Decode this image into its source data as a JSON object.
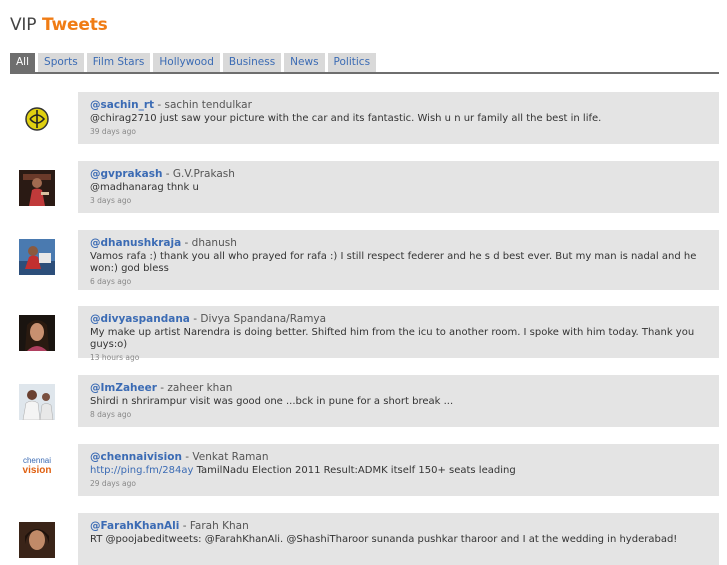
{
  "header": {
    "title_prefix": "VIP",
    "title_accent": "Tweets"
  },
  "tabs": [
    {
      "label": "All",
      "active": true
    },
    {
      "label": "Sports"
    },
    {
      "label": "Film Stars"
    },
    {
      "label": "Hollywood"
    },
    {
      "label": "Business"
    },
    {
      "label": "News"
    },
    {
      "label": "Politics"
    }
  ],
  "tweets": [
    {
      "handle": "@sachin_rt",
      "name": "sachin tendulkar",
      "text": "@chirag2710 just saw your picture with the car and its fantastic. Wish u n ur family all the best in life.",
      "time": "39 days ago",
      "avatar": "sachin-logo-avatar"
    },
    {
      "handle": "@gvprakash",
      "name": "G.V.Prakash",
      "text": "@madhanarag thnk u",
      "time": "3 days ago",
      "avatar": "gvprakash-photo-avatar"
    },
    {
      "handle": "@dhanushkraja",
      "name": "dhanush",
      "text": "Vamos rafa :) thank you all who prayed for rafa :) I still respect federer and he s d best ever. But my man is nadal and he won:) god bless",
      "time": "6 days ago",
      "avatar": "dhanush-photo-avatar"
    },
    {
      "handle": "@divyaspandana",
      "name": "Divya Spandana/Ramya",
      "text": "My make up artist Narendra is doing better. Shifted him from the icu to another room. I spoke with him today. Thank you guys:o)",
      "time": "13 hours ago",
      "avatar": "divya-photo-avatar"
    },
    {
      "handle": "@ImZaheer",
      "name": "zaheer khan",
      "text": "Shirdi n shrirampur visit was good one ...bck in pune for a short break ...",
      "time": "8 days ago",
      "avatar": "zaheer-photo-avatar"
    },
    {
      "handle": "@chennaivision",
      "name": "Venkat Raman",
      "link": "http://ping.fm/284ay",
      "text": "TamilNadu Election 2011 Result:ADMK itself 150+ seats leading",
      "time": "29 days ago",
      "avatar": "chennaivision-logo-avatar",
      "avatar_text_top": "chennai",
      "avatar_text_bottom": "vision"
    },
    {
      "handle": "@FarahKhanAli",
      "name": "Farah Khan",
      "text": "RT @poojabeditweets: @FarahKhanAli. @ShashiTharoor sunanda pushkar tharoor and I at the wedding in hyderabad!",
      "time": "",
      "avatar": "farah-photo-avatar"
    }
  ],
  "separator": " - "
}
